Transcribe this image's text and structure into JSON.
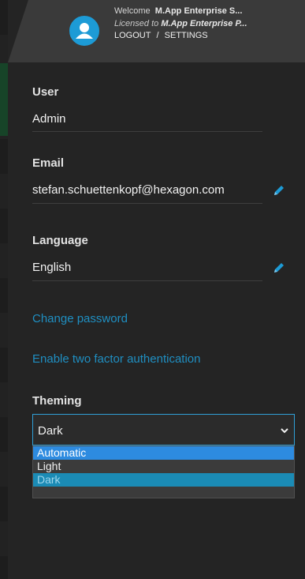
{
  "header": {
    "welcome_prefix": "Welcome",
    "welcome_name": "M.App Enterprise S...",
    "licensed_prefix": "Licensed to",
    "licensed_name": "M.App Enterprise P...",
    "logout_label": "LOGOUT",
    "separator": "/",
    "settings_label": "SETTINGS",
    "avatar_icon": "user-icon",
    "accent_color": "#1d9bd6"
  },
  "profile": {
    "user_label": "User",
    "user_value": "Admin",
    "email_label": "Email",
    "email_value": "stefan.schuettenkopf@hexagon.com",
    "language_label": "Language",
    "language_value": "English",
    "edit_icon": "pencil-icon"
  },
  "links": {
    "change_password": "Change password",
    "two_factor": "Enable two factor authentication"
  },
  "theming": {
    "label": "Theming",
    "selected": "Dark",
    "options": [
      "Automatic",
      "Light",
      "Dark"
    ],
    "highlighted": "Automatic"
  }
}
